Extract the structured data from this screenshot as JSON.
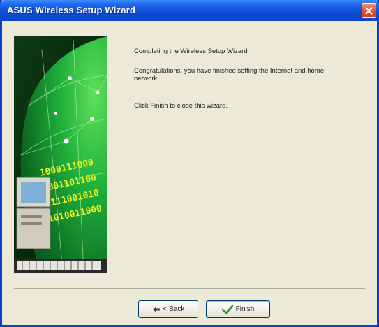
{
  "window": {
    "title": "ASUS Wireless Setup Wizard"
  },
  "content": {
    "heading": "Completing the Wireless Setup Wizard",
    "message": "Congratulations, you have finished setting the Internet and home network!",
    "instruction": "Click Finish to close this wizard."
  },
  "buttons": {
    "back_label": "< Back",
    "finish_label": "Finish"
  },
  "icons": {
    "close": "close-icon",
    "back": "back-arrow-icon",
    "finish": "checkmark-icon"
  },
  "colors": {
    "titlebar": "#0A4ED6",
    "close": "#E0532E",
    "dialog_bg": "#ECE9D8",
    "banner_green": "#1FAF3A",
    "checkmark": "#2E8B2E"
  }
}
